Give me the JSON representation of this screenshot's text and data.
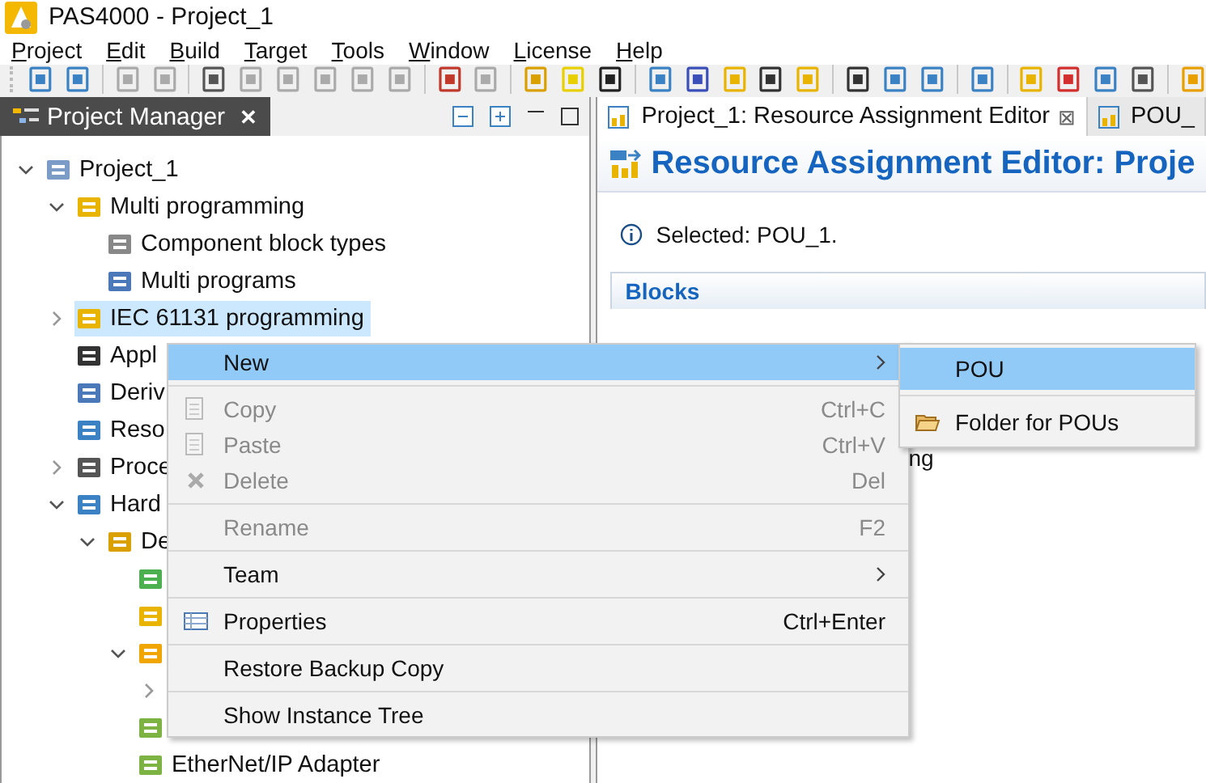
{
  "window": {
    "title": "PAS4000 - Project_1"
  },
  "menu_bar": [
    "Project",
    "Edit",
    "Build",
    "Target",
    "Tools",
    "Window",
    "License",
    "Help"
  ],
  "project_manager": {
    "title": "Project Manager",
    "close": "✕",
    "selected": true,
    "tree": [
      {
        "label": "Project_1",
        "expanded": true,
        "selected": false,
        "children": [
          {
            "label": "Multi programming",
            "expanded": true,
            "selected": false,
            "children": [
              {
                "label": "Component block types",
                "selected": false
              },
              {
                "label": "Multi programs",
                "selected": false
              }
            ]
          },
          {
            "label": "IEC 61131 programming",
            "expanded": false,
            "selected": true
          },
          {
            "label": "Appl",
            "selected": false
          },
          {
            "label": "Deriv",
            "selected": false
          },
          {
            "label": "Reso",
            "selected": false
          },
          {
            "label": "Proce",
            "expanded": false,
            "selected": false
          },
          {
            "label": "Hard",
            "expanded": true,
            "selected": false,
            "children": [
              {
                "label": "De",
                "expanded": true,
                "selected": false,
                "children": [
                  {
                    "selected": false
                  },
                  {
                    "selected": false
                  },
                  {
                    "expanded": true,
                    "selected": false,
                    "children": [
                      {
                        "expanded": false,
                        "selected": false
                      }
                    ]
                  },
                  {
                    "selected": false
                  },
                  {
                    "label": "EtherNet/IP Adapter",
                    "selected": false
                  }
                ]
              }
            ]
          }
        ]
      }
    ]
  },
  "editor": {
    "tabs": [
      {
        "label": "Project_1: Resource Assignment Editor",
        "selected": true,
        "close": "⊠"
      },
      {
        "label": "POU_",
        "selected": false
      }
    ],
    "heading": "Resource Assignment Editor: Proje",
    "info": "Selected: POU_1.",
    "section": "Blocks",
    "partial_text": "ng"
  },
  "context_menu": [
    {
      "label": "New",
      "selected": true,
      "disabled": false,
      "submenu": true,
      "separator_before": false
    },
    {
      "label": "Copy",
      "shortcut": "Ctrl+C",
      "selected": false,
      "disabled": true,
      "submenu": false,
      "separator_before": true
    },
    {
      "label": "Paste",
      "shortcut": "Ctrl+V",
      "selected": false,
      "disabled": true,
      "submenu": false,
      "separator_before": false
    },
    {
      "label": "Delete",
      "shortcut": "Del",
      "selected": false,
      "disabled": true,
      "submenu": false,
      "separator_before": false
    },
    {
      "label": "Rename",
      "shortcut": "F2",
      "selected": false,
      "disabled": true,
      "submenu": false,
      "separator_before": true
    },
    {
      "label": "Team",
      "selected": false,
      "disabled": false,
      "submenu": true,
      "separator_before": true
    },
    {
      "label": "Properties",
      "shortcut": "Ctrl+Enter",
      "selected": false,
      "disabled": false,
      "submenu": false,
      "separator_before": true
    },
    {
      "label": "Restore Backup Copy",
      "selected": false,
      "disabled": false,
      "submenu": false,
      "separator_before": true
    },
    {
      "label": "Show Instance Tree",
      "selected": false,
      "disabled": false,
      "submenu": false,
      "separator_before": true
    }
  ],
  "submenu": [
    {
      "label": "POU",
      "selected": true,
      "separator_before": false
    },
    {
      "label": "Folder for POUs",
      "selected": false,
      "separator_before": true
    }
  ]
}
